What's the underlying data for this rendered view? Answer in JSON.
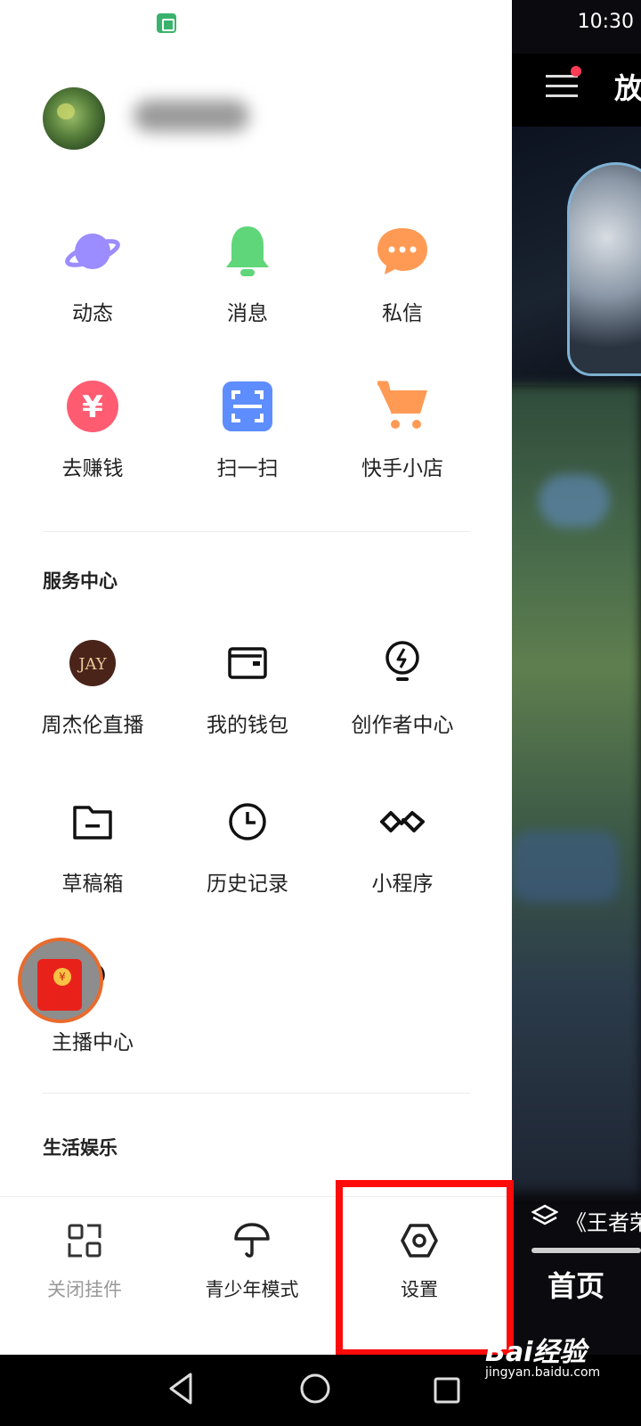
{
  "status_bar": {
    "time": "10:30"
  },
  "profile": {
    "avatar": "avatar-image",
    "username_blurred": ""
  },
  "quick_actions": [
    {
      "label": "动态",
      "icon": "planet-icon",
      "color": "#9b8cff"
    },
    {
      "label": "消息",
      "icon": "bell-icon",
      "color": "#5fd67a"
    },
    {
      "label": "私信",
      "icon": "chat-bubble-icon",
      "color": "#ff9a55"
    },
    {
      "label": "去赚钱",
      "icon": "yen-coin-icon",
      "color": "#ff5c72"
    },
    {
      "label": "扫一扫",
      "icon": "scan-icon",
      "color": "#5d8dff"
    },
    {
      "label": "快手小店",
      "icon": "shopping-cart-icon",
      "color": "#ff9a55"
    }
  ],
  "service_center": {
    "title": "服务中心",
    "items": [
      {
        "label": "周杰伦直播",
        "icon": "jay-logo-icon"
      },
      {
        "label": "我的钱包",
        "icon": "wallet-icon"
      },
      {
        "label": "创作者中心",
        "icon": "lightbulb-icon"
      },
      {
        "label": "草稿箱",
        "icon": "folder-icon"
      },
      {
        "label": "历史记录",
        "icon": "clock-icon"
      },
      {
        "label": "小程序",
        "icon": "mini-program-icon"
      },
      {
        "label": "主播中心",
        "icon": "anchor-icon"
      }
    ]
  },
  "life_section": {
    "title": "生活娱乐"
  },
  "jay_logo_text": "JAY",
  "bottom_actions": [
    {
      "label": "关闭挂件",
      "icon": "widget-icon"
    },
    {
      "label": "青少年模式",
      "icon": "umbrella-icon"
    },
    {
      "label": "设置",
      "icon": "settings-hexagon-icon"
    }
  ],
  "background_app": {
    "top_text": "放",
    "caption": "《王者荣",
    "tab_home": "首页"
  },
  "watermark": {
    "brand": "Bai经验",
    "site": "jingyan.baidu.com"
  },
  "colors": {
    "highlight": "#ff0a0a",
    "redpacket": "#e8221b"
  }
}
